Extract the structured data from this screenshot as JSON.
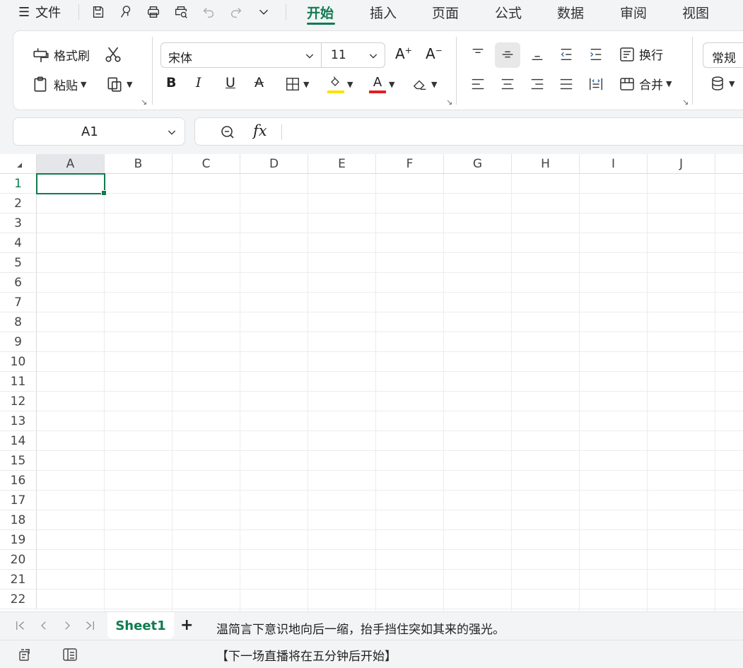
{
  "menubar": {
    "file_label": "文件",
    "tabs": [
      "开始",
      "插入",
      "页面",
      "公式",
      "数据",
      "审阅",
      "视图"
    ],
    "active_tab": "开始"
  },
  "ribbon": {
    "format_painter": "格式刷",
    "paste": "粘贴",
    "font_name": "宋体",
    "font_size": "11",
    "wrap_text": "换行",
    "merge": "合并",
    "number_format": "常规",
    "highlight_color": "#f5e400",
    "font_color": "#e02020"
  },
  "formula_bar": {
    "cell_ref": "A1",
    "fx_label": "fx",
    "content": ""
  },
  "grid": {
    "columns": [
      "A",
      "B",
      "C",
      "D",
      "E",
      "F",
      "G",
      "H",
      "I",
      "J"
    ],
    "rows": [
      "1",
      "2",
      "3",
      "4",
      "5",
      "6",
      "7",
      "8",
      "9",
      "10",
      "11",
      "12",
      "13",
      "14",
      "15",
      "16",
      "17",
      "18",
      "19",
      "20",
      "21",
      "22"
    ],
    "active_cell": "A1"
  },
  "sheets": {
    "tabs": [
      "Sheet1"
    ],
    "active": "Sheet1",
    "add_label": "+"
  },
  "overlay": {
    "subtitle_line1": "温简言下意识地向后一缩，抬手挡住突如其来的强光。",
    "subtitle_line2": "【下一场直播将在五分钟后开始】"
  },
  "colors": {
    "accent": "#0f7c4f"
  }
}
